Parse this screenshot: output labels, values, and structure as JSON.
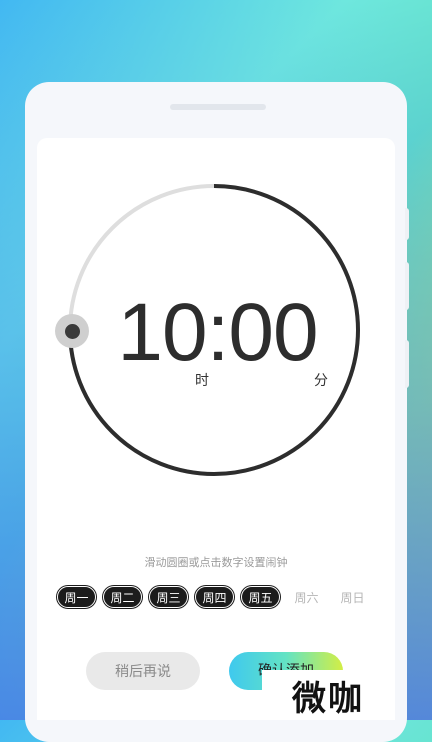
{
  "clock": {
    "hour": "10",
    "separator": ":",
    "minute": "00",
    "hour_unit": "时",
    "minute_unit": "分"
  },
  "hint": "滑动圆圈或点击数字设置闹钟",
  "days": [
    {
      "label": "周一",
      "selected": true
    },
    {
      "label": "周二",
      "selected": true
    },
    {
      "label": "周三",
      "selected": true
    },
    {
      "label": "周四",
      "selected": true
    },
    {
      "label": "周五",
      "selected": true
    },
    {
      "label": "周六",
      "selected": false
    },
    {
      "label": "周日",
      "selected": false
    }
  ],
  "buttons": {
    "later": "稍后再说",
    "confirm": "确认添加"
  },
  "watermark": "微咖",
  "colors": {
    "accent_dark": "#2d2d2d",
    "ring_track": "#dedede",
    "gradient_start": "#3fc9ee",
    "gradient_end": "#d3ee45"
  }
}
